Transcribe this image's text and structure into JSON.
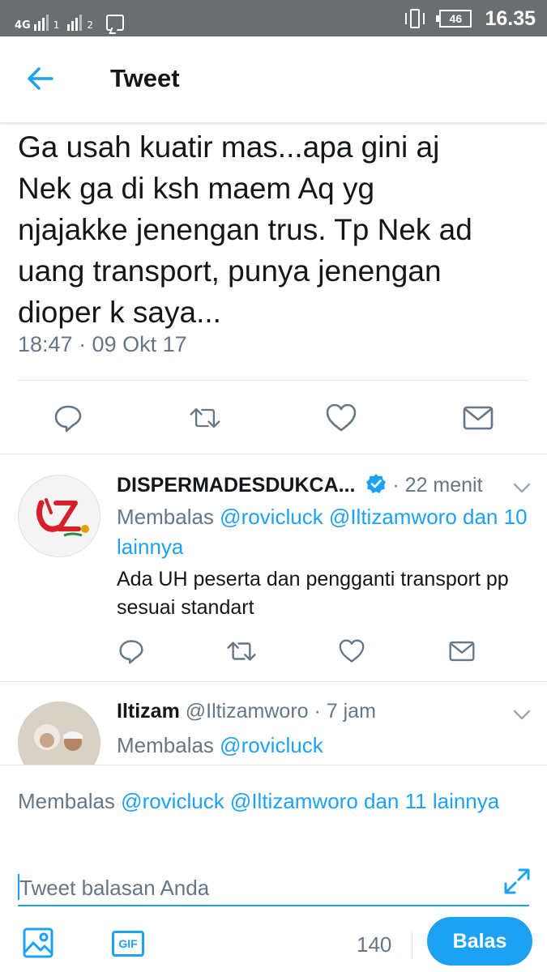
{
  "status_bar": {
    "network": "4G",
    "sim1": "1",
    "sim2": "2",
    "battery": "46",
    "time": "16.35"
  },
  "header": {
    "title": "Tweet",
    "back_icon": "arrow-left-icon"
  },
  "tweet": {
    "text": "Ga usah kuatir mas...apa gini aj\nNek ga di ksh maem Aq yg\nnjajakke jenengan trus. Tp Nek ad\nuang transport, punya jenengan\ndioper k saya...",
    "timestamp": "18:47 · 09 Okt 17"
  },
  "replies": [
    {
      "name": "DISPERMADESDUKCA...",
      "handle": "",
      "time": "· 22 menit",
      "verified": true,
      "replying_prefix": "Membalas",
      "replying_to": "@rovicluck @Iltizamworo dan 10 lainnya",
      "text": "Ada UH peserta dan pengganti transport pp sesuai standart"
    },
    {
      "name": "Iltizam",
      "handle": "@Iltizamworo",
      "time": "· 7 jam",
      "verified": false,
      "replying_prefix": "Membalas",
      "replying_to": "@rovicluck",
      "text": ""
    }
  ],
  "compose": {
    "replying_prefix": "Membalas",
    "replying_to": "@rovicluck @Iltizamworo dan 11 lainnya",
    "placeholder": "Tweet balasan Anda",
    "gif_label": "GIF",
    "counter": "140",
    "submit_label": "Balas"
  },
  "colors": {
    "accent": "#1da1f2",
    "muted": "#657786",
    "status_bar": "#6b6e70"
  }
}
